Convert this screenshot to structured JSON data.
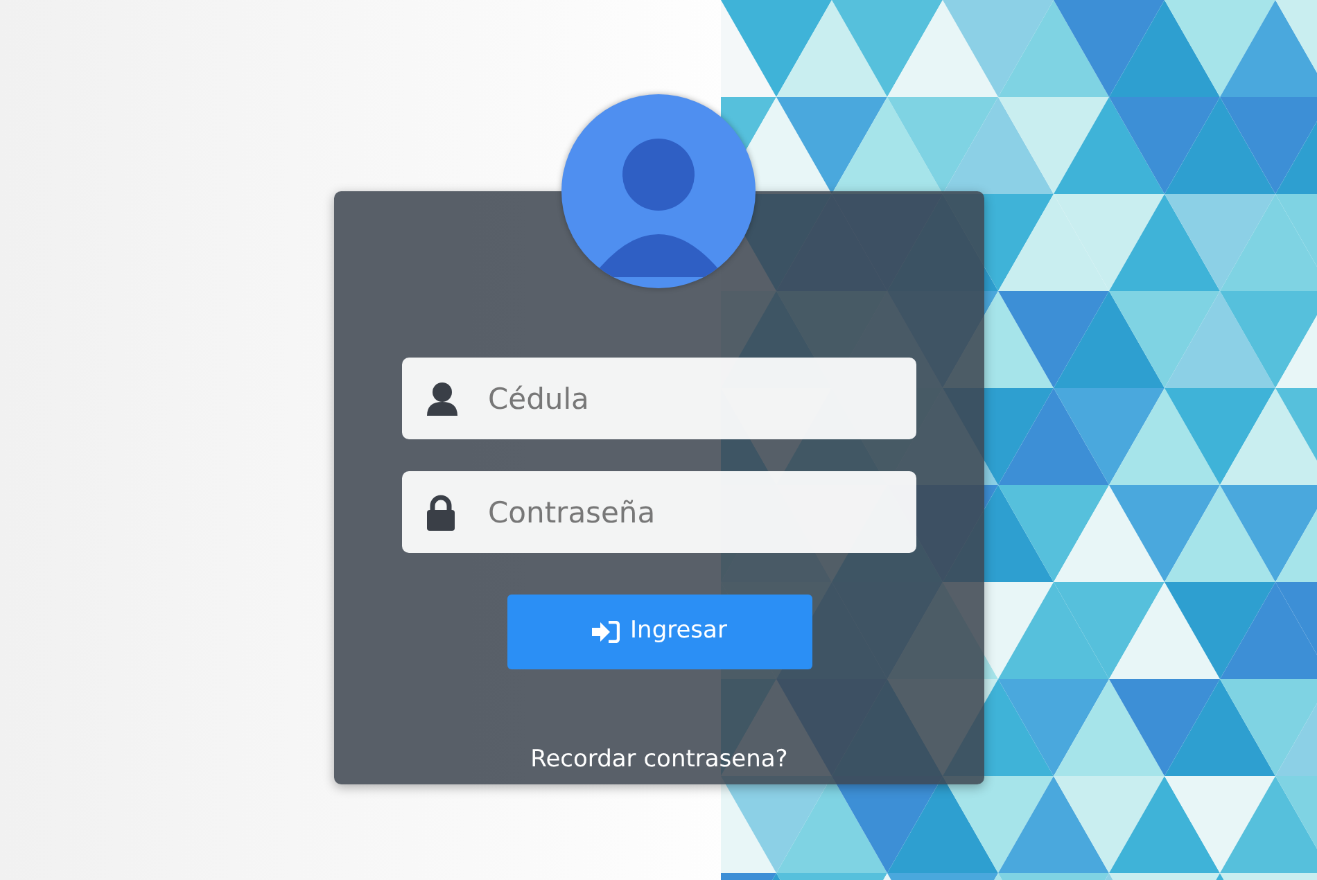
{
  "login_form": {
    "fields": [
      {
        "kind": "user",
        "placeholder": "Cédula"
      },
      {
        "kind": "password",
        "placeholder": "Contraseña"
      }
    ],
    "submit_button": {
      "label": "Ingresar"
    },
    "forgot_link": "Recordar contrasena?"
  }
}
